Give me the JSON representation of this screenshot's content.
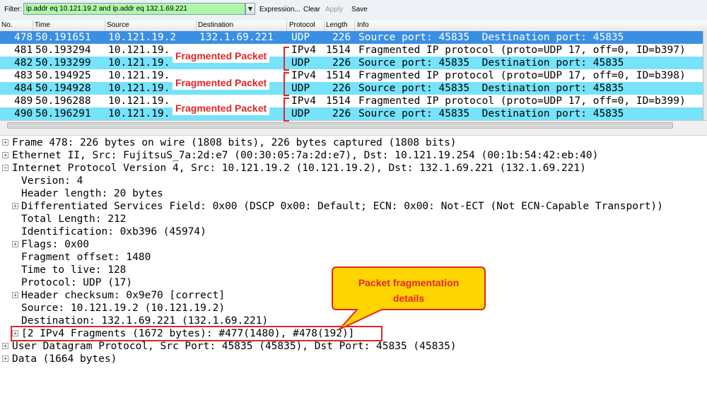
{
  "filter": {
    "label": "Filter:",
    "value": "ip.addr eq 10.121.19.2 and ip.addr eq 132.1.69.221",
    "dropdown_glyph": "▼",
    "expression_label": "Expression...",
    "clear_label": "Clear",
    "apply_label": "Apply",
    "save_label": "Save"
  },
  "packet_list": {
    "columns": [
      "No.",
      "Time",
      "Source",
      "Destination",
      "Protocol",
      "Length",
      "Info"
    ],
    "rows": [
      {
        "no": "478",
        "time": "50.191651",
        "src": "10.121.19.2",
        "dst": "132.1.69.221",
        "proto": "UDP",
        "len": "226",
        "info": "Source port: 45835  Destination port: 45835"
      },
      {
        "no": "481",
        "time": "50.193294",
        "src": "10.121.19.",
        "dst": "",
        "proto": "IPv4",
        "len": "1514",
        "info": "Fragmented IP protocol (proto=UDP 17, off=0, ID=b397)"
      },
      {
        "no": "482",
        "time": "50.193299",
        "src": "10.121.19.",
        "dst": "",
        "proto": "UDP",
        "len": "226",
        "info": "Source port: 45835  Destination port: 45835"
      },
      {
        "no": "483",
        "time": "50.194925",
        "src": "10.121.19.",
        "dst": "",
        "proto": "IPv4",
        "len": "1514",
        "info": "Fragmented IP protocol (proto=UDP 17, off=0, ID=b398)"
      },
      {
        "no": "484",
        "time": "50.194928",
        "src": "10.121.19.",
        "dst": "",
        "proto": "UDP",
        "len": "226",
        "info": "Source port: 45835  Destination port: 45835"
      },
      {
        "no": "489",
        "time": "50.196288",
        "src": "10.121.19.",
        "dst": "",
        "proto": "IPv4",
        "len": "1514",
        "info": "Fragmented IP protocol (proto=UDP 17, off=0, ID=b399)"
      },
      {
        "no": "490",
        "time": "50.196291",
        "src": "10.121.19.",
        "dst": "",
        "proto": "UDP",
        "len": "226",
        "info": "Source port: 45835  Destination port: 45835"
      }
    ]
  },
  "details": {
    "frame": "Frame 478: 226 bytes on wire (1808 bits), 226 bytes captured (1808 bits)",
    "ethernet": "Ethernet II, Src: FujitsuS_7a:2d:e7 (00:30:05:7a:2d:e7), Dst: 10.121.19.254 (00:1b:54:42:eb:40)",
    "ip": "Internet Protocol Version 4, Src: 10.121.19.2 (10.121.19.2), Dst: 132.1.69.221 (132.1.69.221)",
    "version": "Version: 4",
    "header_length": "Header length: 20 bytes",
    "dsfield": "Differentiated Services Field: 0x00 (DSCP 0x00: Default; ECN: 0x00: Not-ECT (Not ECN-Capable Transport))",
    "total_length": "Total Length: 212",
    "identification": "Identification: 0xb396 (45974)",
    "flags": "Flags: 0x00",
    "fragment_offset": "Fragment offset: 1480",
    "ttl": "Time to live: 128",
    "protocol": "Protocol: UDP (17)",
    "checksum": "Header checksum: 0x9e70 [correct]",
    "source": "Source: 10.121.19.2 (10.121.19.2)",
    "destination": "Destination: 132.1.69.221 (132.1.69.221)",
    "fragments": "[2 IPv4 Fragments (1672 bytes): #477(1480), #478(192)]",
    "udp": "User Datagram Protocol, Src Port: 45835 (45835), Dst Port: 45835 (45835)",
    "data": "Data (1664 bytes)"
  },
  "expand_glyph_plus": "+",
  "expand_glyph_minus": "−",
  "annotations": {
    "fragmented_packet": "Fragmented Packet",
    "callout_line1": "Packet fragmentation",
    "callout_line2": "details"
  },
  "colors": {
    "cyan_row": "#76e3fb",
    "selected_row": "#3a8fe3",
    "annotation_red": "#e32525",
    "callout_fill": "#ffd500",
    "filter_ok": "#aff7a8"
  }
}
